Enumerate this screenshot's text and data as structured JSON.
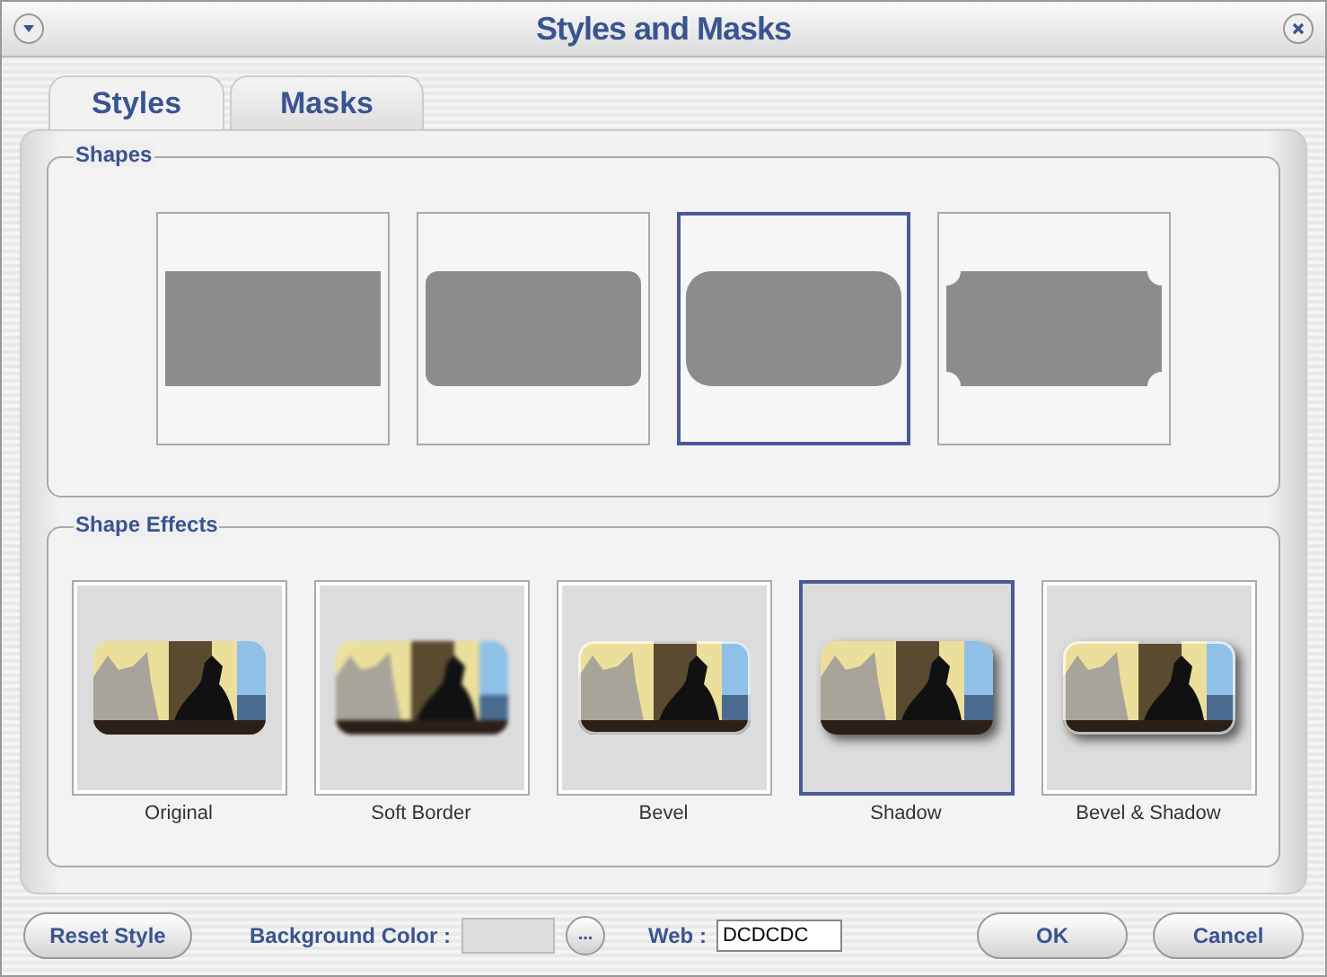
{
  "window": {
    "title": "Styles and Masks"
  },
  "tabs": [
    {
      "label": "Styles",
      "selected": true
    },
    {
      "label": "Masks",
      "selected": false
    }
  ],
  "shapes": {
    "title": "Shapes",
    "items": [
      {
        "kind": "rectangle",
        "selected": false
      },
      {
        "kind": "rounded-small",
        "selected": false
      },
      {
        "kind": "rounded",
        "selected": true
      },
      {
        "kind": "notched",
        "selected": false
      }
    ]
  },
  "shape_effects": {
    "title": "Shape Effects",
    "items": [
      {
        "kind": "plain",
        "label": "Original",
        "selected": false
      },
      {
        "kind": "soft",
        "label": "Soft Border",
        "selected": false
      },
      {
        "kind": "bevel",
        "label": "Bevel",
        "selected": false
      },
      {
        "kind": "shadow",
        "label": "Shadow",
        "selected": true
      },
      {
        "kind": "bevel-shadow",
        "label": "Bevel & Shadow",
        "selected": false
      }
    ]
  },
  "footer": {
    "reset_button": "Reset Style",
    "background_label": "Background Color :",
    "browse_button": "...",
    "web_label": "Web :",
    "web_value": "DCDCDC",
    "ok_button": "OK",
    "cancel_button": "Cancel"
  }
}
